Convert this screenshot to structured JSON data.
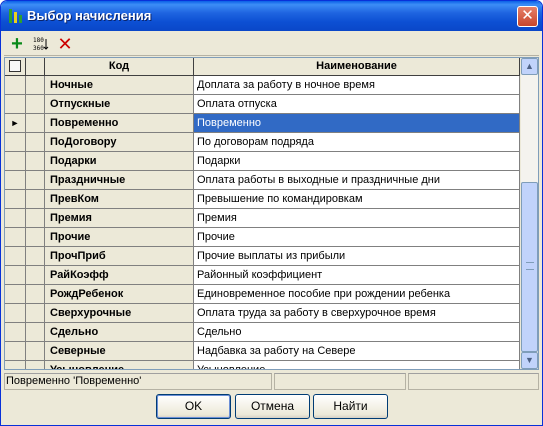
{
  "window": {
    "title": "Выбор начисления"
  },
  "toolbar": {
    "sort_label": "180\n360"
  },
  "table": {
    "columns": {
      "code": "Код",
      "name": "Наименование"
    },
    "rows": [
      {
        "code": "Ночные",
        "name": "Доплата за работу в ночное время",
        "selected": false
      },
      {
        "code": "Отпускные",
        "name": "Оплата отпуска",
        "selected": false
      },
      {
        "code": "Повременно",
        "name": "Повременно",
        "selected": true
      },
      {
        "code": "ПоДоговору",
        "name": "По договорам подряда",
        "selected": false
      },
      {
        "code": "Подарки",
        "name": "Подарки",
        "selected": false
      },
      {
        "code": "Праздничные",
        "name": "Оплата работы в выходные и праздничные дни",
        "selected": false
      },
      {
        "code": "ПревКом",
        "name": "Превышение по командировкам",
        "selected": false
      },
      {
        "code": "Премия",
        "name": "Премия",
        "selected": false
      },
      {
        "code": "Прочие",
        "name": "Прочие",
        "selected": false
      },
      {
        "code": "ПрочПриб",
        "name": "Прочие выплаты из прибыли",
        "selected": false
      },
      {
        "code": "РайКоэфф",
        "name": "Районный коэффициент",
        "selected": false
      },
      {
        "code": "РождРебенок",
        "name": "Единовременное пособие при рождении ребенка",
        "selected": false
      },
      {
        "code": "Сверхурочные",
        "name": "Оплата труда за работу в сверхурочное время",
        "selected": false
      },
      {
        "code": "Сдельно",
        "name": "Сдельно",
        "selected": false
      },
      {
        "code": "Северные",
        "name": "Надбавка за работу на Севере",
        "selected": false
      },
      {
        "code": "Усыновление",
        "name": "Усыновление",
        "selected": false
      }
    ]
  },
  "status": {
    "text": "Повременно 'Повременно'"
  },
  "buttons": {
    "ok": "OK",
    "cancel": "Отмена",
    "find": "Найти"
  }
}
